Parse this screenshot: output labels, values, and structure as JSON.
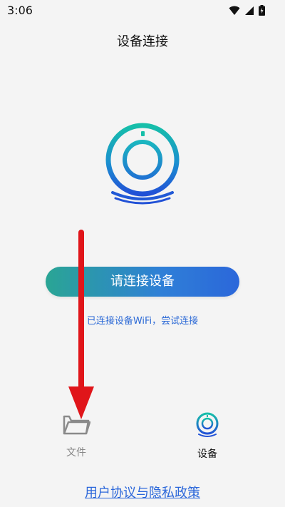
{
  "status_bar": {
    "time": "3:06",
    "icons": [
      "wifi-icon",
      "signal-icon",
      "battery-icon"
    ]
  },
  "header": {
    "title": "设备连接"
  },
  "main": {
    "illustration": "camera-device-icon",
    "connect_button_label": "请连接设备",
    "wifi_hint": "已连接设备WiFi，尝试连接"
  },
  "tabs": [
    {
      "label": "文件",
      "icon": "folder-icon",
      "active": false
    },
    {
      "label": "设备",
      "icon": "device-icon",
      "active": true
    }
  ],
  "footer": {
    "policy_link": "用户协议与隐私政策"
  },
  "colors": {
    "accent_blue": "#2b67da",
    "accent_teal": "#1bb6a4",
    "annotation_red": "#e0151a"
  }
}
